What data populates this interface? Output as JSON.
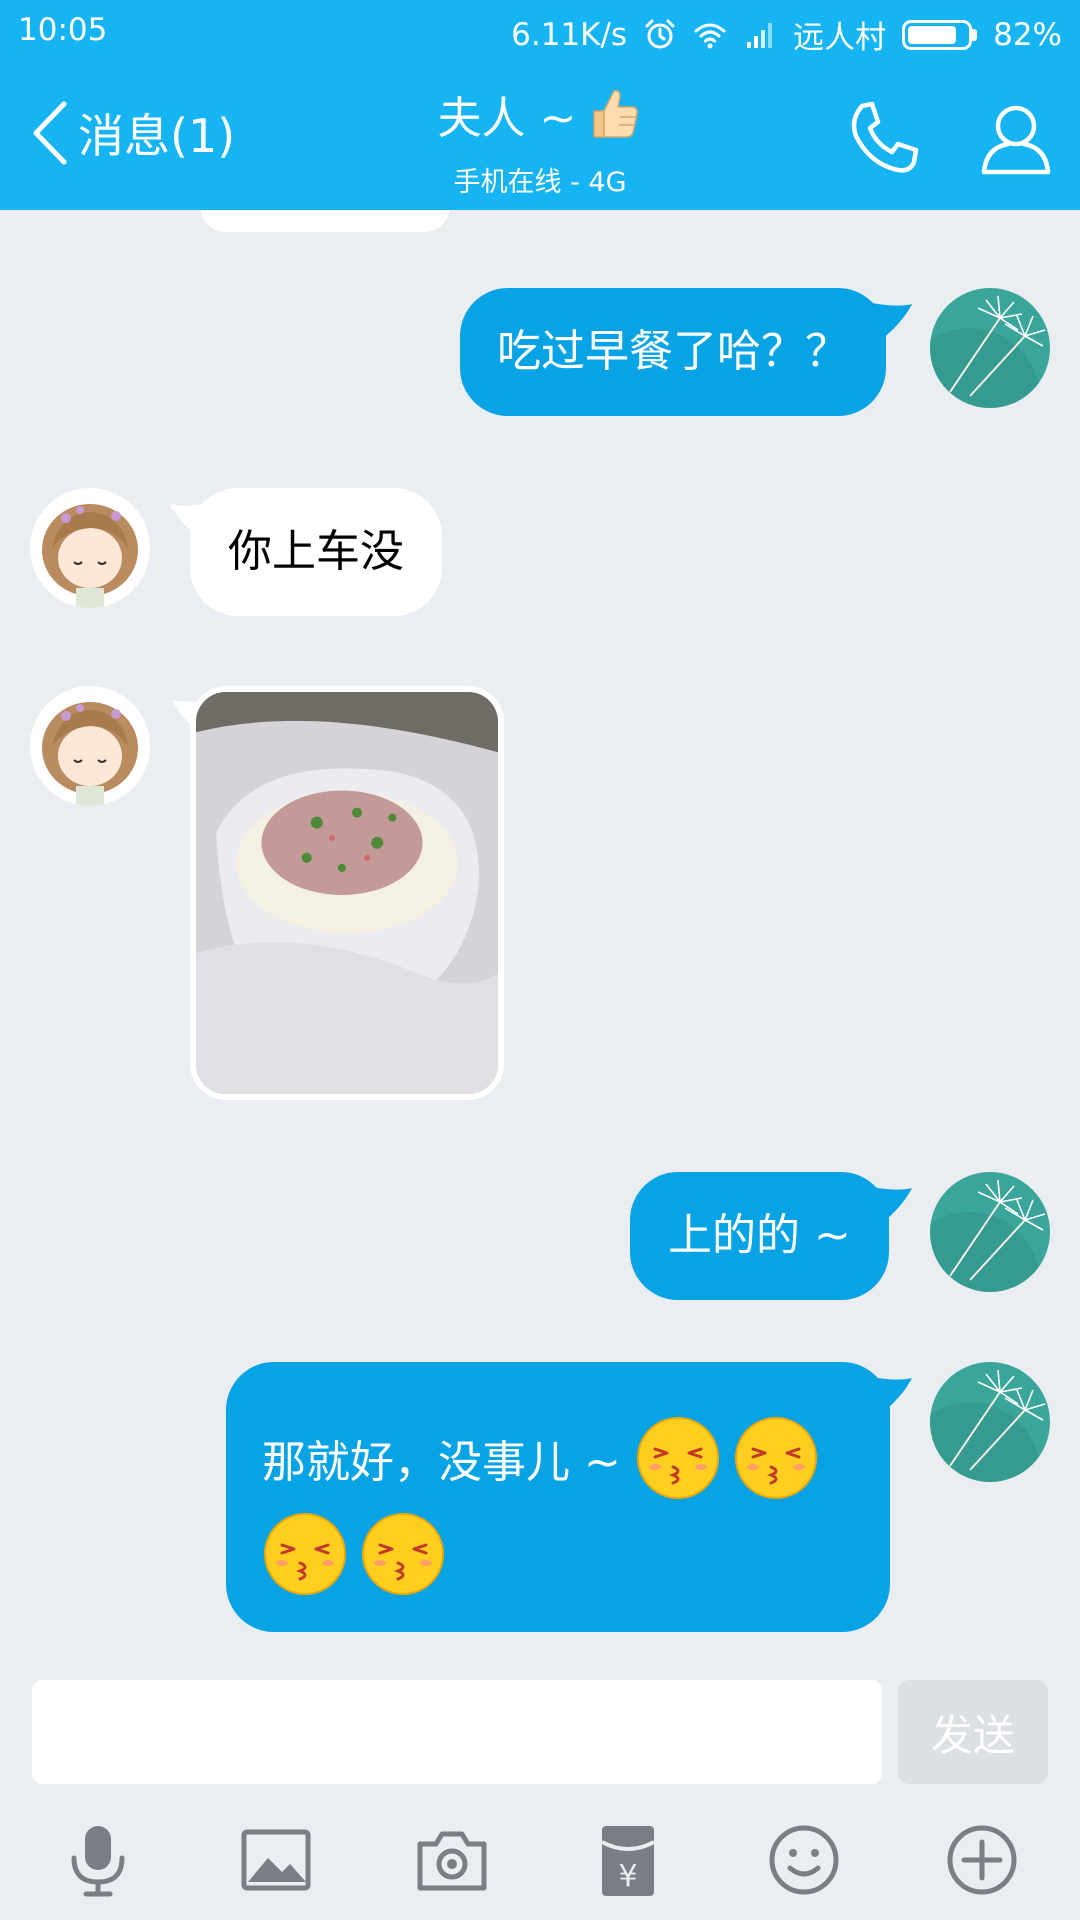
{
  "status_bar": {
    "time": "10:05",
    "net_speed": "6.11K/s",
    "carrier": "远人村",
    "battery_percent": "82%",
    "battery_level": 0.82,
    "icons": [
      "alarm-icon",
      "wifi-icon",
      "signal-icon",
      "battery-icon"
    ]
  },
  "header": {
    "back_label": "消息(1)",
    "title": "夫人 ~",
    "title_icon": "thumbs-up-icon",
    "subtitle": "手机在线 - 4G",
    "right_icons": [
      "phone-icon",
      "profile-icon"
    ],
    "background": "#16b4f2"
  },
  "messages": [
    {
      "direction": "out",
      "type": "text",
      "text": "吃过早餐了哈？？"
    },
    {
      "direction": "in",
      "type": "text",
      "text": "你上车没"
    },
    {
      "direction": "in",
      "type": "image",
      "content": "food-photo"
    },
    {
      "direction": "out",
      "type": "text",
      "text": "上的的 ~"
    },
    {
      "direction": "out",
      "type": "text_emoji",
      "text": "那就好，没事儿 ~",
      "emoji": "kiss-emoji",
      "emoji_count": 4
    }
  ],
  "composer": {
    "input_value": "",
    "send_label": "发送",
    "tools": [
      "microphone-icon",
      "image-icon",
      "camera-icon",
      "red-packet-icon",
      "emoji-icon",
      "plus-icon"
    ]
  },
  "colors": {
    "accent": "#16b4f2",
    "outgoing_bubble": "#08a3e4",
    "incoming_bubble": "#ffffff",
    "background": "#eaedf1"
  }
}
